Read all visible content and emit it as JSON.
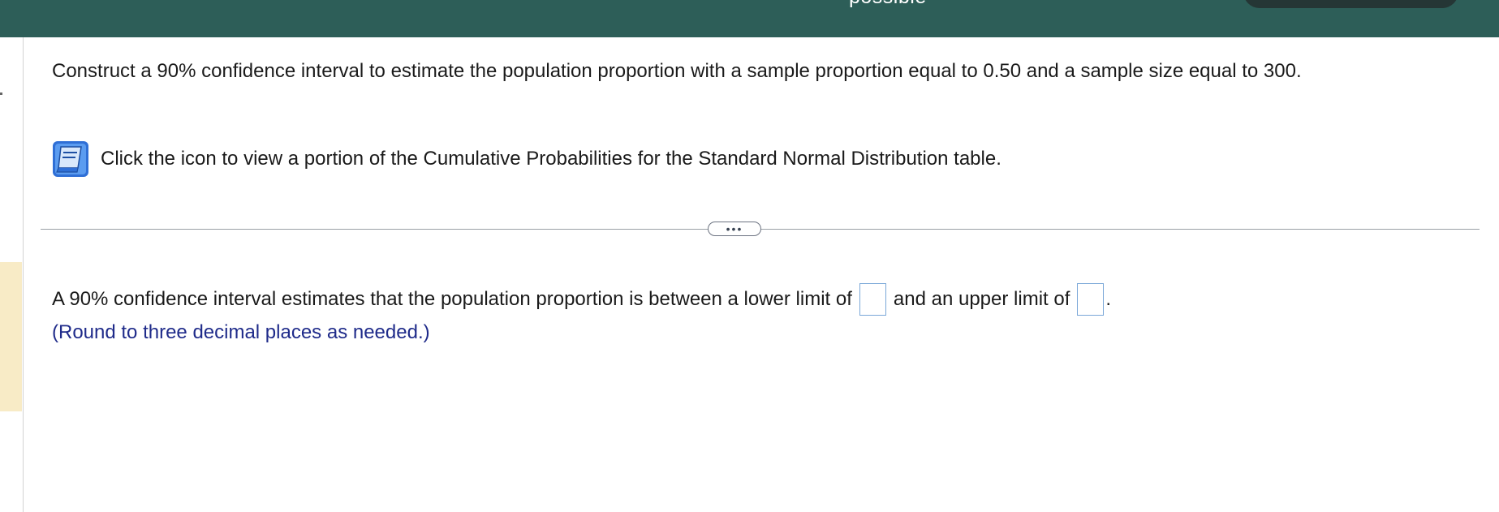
{
  "header": {
    "partial_text": "possible"
  },
  "question": {
    "text": "Construct a 90% confidence interval to estimate the population proportion with a sample proportion equal to 0.50 and a sample size equal to 300."
  },
  "table_link": {
    "icon": "table-book-icon",
    "text": "Click the icon to view a portion of the Cumulative Probabilities for the Standard Normal Distribution table."
  },
  "divider": {
    "more_label": "•••"
  },
  "answer": {
    "prefix": "A 90% confidence interval estimates that the population proportion is between a lower limit of",
    "lower_value": "",
    "middle": "and an upper limit of",
    "upper_value": "",
    "suffix": "."
  },
  "hint": {
    "text": "(Round to three decimal places as needed.)"
  },
  "colors": {
    "header_bg": "#2d5e58",
    "hint_text": "#1f2b8a",
    "input_border": "#7aa7d8",
    "rail_highlight": "#f8ebc6"
  }
}
